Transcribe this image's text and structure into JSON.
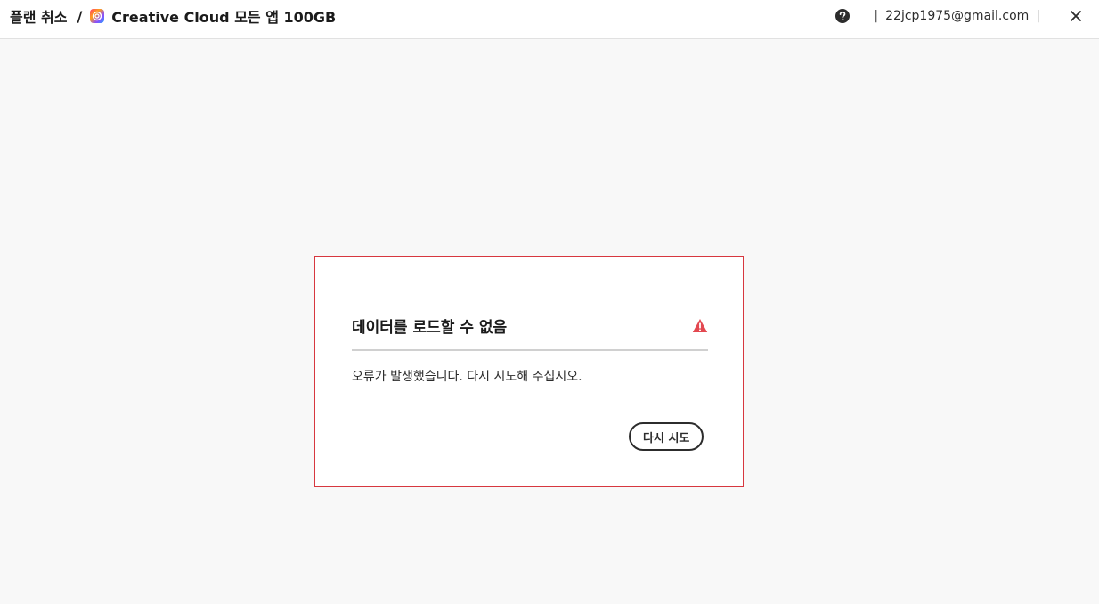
{
  "header": {
    "breadcrumb_root": "플랜 취소",
    "breadcrumb_separator": "/",
    "breadcrumb_current": "Creative Cloud 모든 앱 100GB",
    "user_email": "22jcp1975@gmail.com",
    "pipe": "|",
    "help_icon": "question-circle-icon",
    "close_icon": "close-icon",
    "logo_icon": "creative-cloud-logo-icon"
  },
  "error_card": {
    "title": "데이터를 로드할 수 없음",
    "message": "오류가 발생했습니다. 다시 시도해 주십시오.",
    "retry_label": "다시 시도",
    "alert_icon": "alert-triangle-icon",
    "border_color": "#d7373f",
    "alert_color": "#e34850"
  }
}
